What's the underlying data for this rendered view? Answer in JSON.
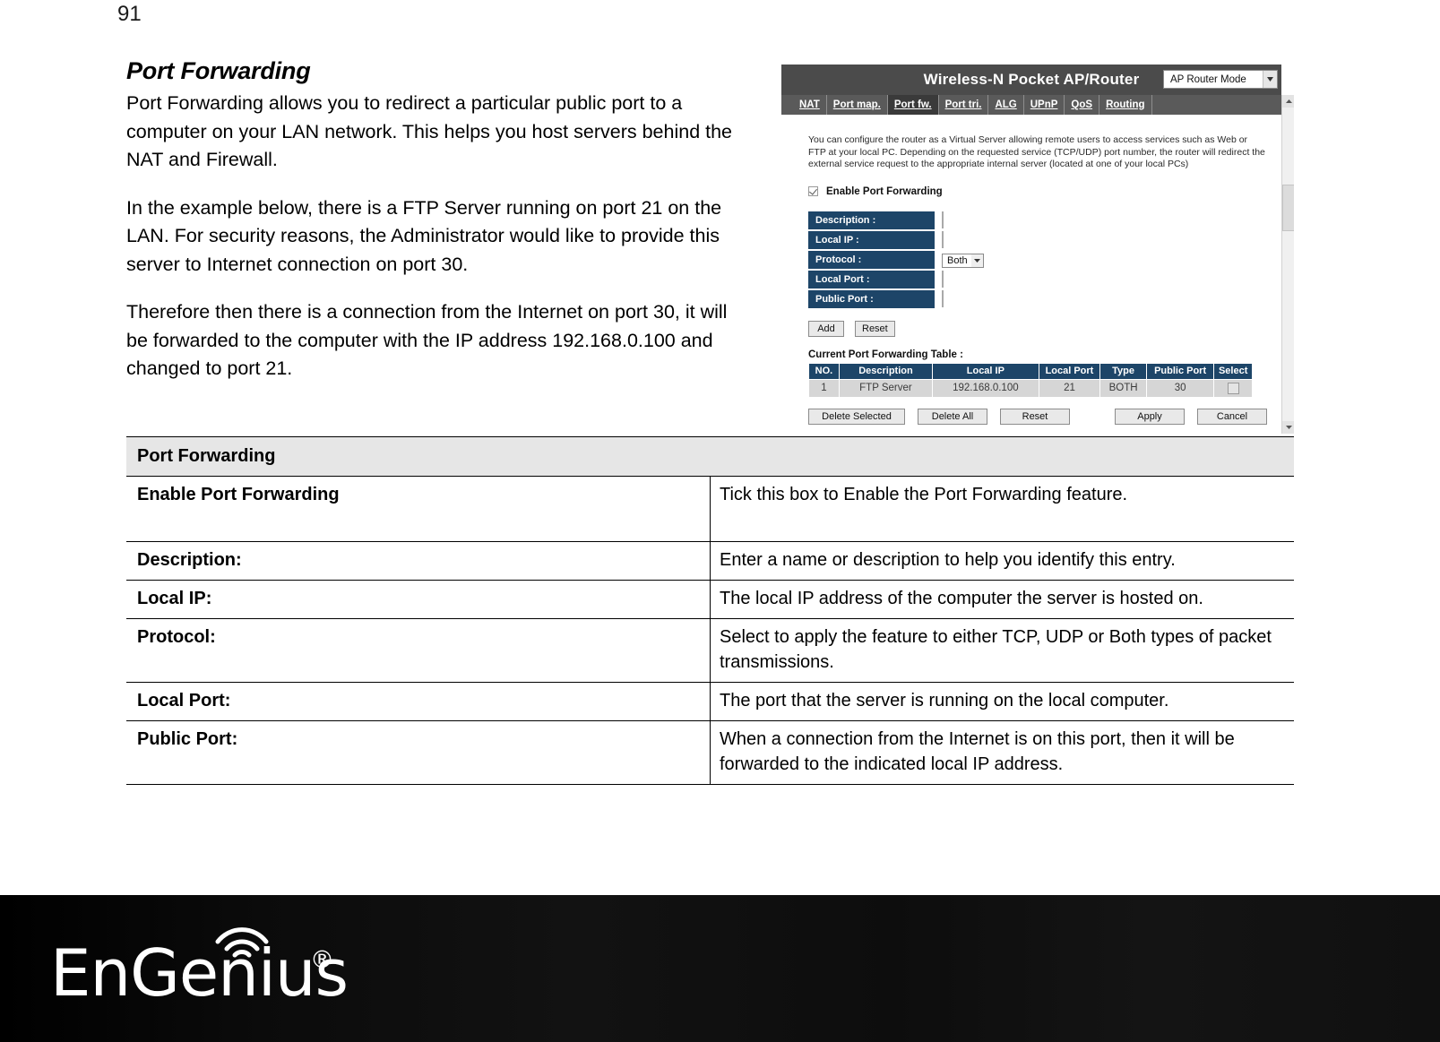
{
  "page": {
    "number": "91"
  },
  "doc": {
    "section_title": "Port Forwarding",
    "paragraphs": [
      "Port Forwarding allows you to redirect a particular public port to a computer on your LAN network. This helps you host servers behind the NAT and Firewall.",
      "In the example below, there is a FTP Server running on port 21 on the LAN. For security reasons, the Administrator would like to provide this server to Internet connection on port 30.",
      "Therefore then there is a connection from the Internet on port 30, it will be forwarded to the computer with the IP address 192.168.0.100 and changed to port 21."
    ]
  },
  "screenshot": {
    "title": "Wireless-N Pocket AP/Router",
    "mode_select": {
      "value": "AP Router Mode",
      "arrow_icon": "chevron-down-icon"
    },
    "nav": [
      {
        "label": "NAT",
        "active": false
      },
      {
        "label": "Port map.",
        "active": false
      },
      {
        "label": "Port fw.",
        "active": true
      },
      {
        "label": "Port tri.",
        "active": false
      },
      {
        "label": "ALG",
        "active": false
      },
      {
        "label": "UPnP",
        "active": false
      },
      {
        "label": "QoS",
        "active": false
      },
      {
        "label": "Routing",
        "active": false
      }
    ],
    "intro": "You can configure the router as a Virtual Server allowing remote users to access services such as Web or FTP at your local PC. Depending on the requested service (TCP/UDP) port number, the router will redirect the external service request to the appropriate internal server (located at one of your local PCs)",
    "enable_checkbox": {
      "label": "Enable Port Forwarding",
      "checked": true
    },
    "form": [
      {
        "label": "Description :",
        "value": "",
        "control": "text"
      },
      {
        "label": "Local IP :",
        "value": "",
        "control": "text"
      },
      {
        "label": "Protocol :",
        "value": "Both",
        "control": "select"
      },
      {
        "label": "Local Port :",
        "value": "",
        "control": "text"
      },
      {
        "label": "Public Port :",
        "value": "",
        "control": "text"
      }
    ],
    "form_buttons": [
      "Add",
      "Reset"
    ],
    "table_caption": "Current Port Forwarding Table :",
    "table_headers": [
      "NO.",
      "Description",
      "Local IP",
      "Local Port",
      "Type",
      "Public Port",
      "Select"
    ],
    "table_rows": [
      {
        "no": "1",
        "description": "FTP Server",
        "local_ip": "192.168.0.100",
        "local_port": "21",
        "type": "BOTH",
        "public_port": "30",
        "selected": false
      }
    ],
    "bottom_buttons_left": [
      "Delete Selected",
      "Delete All",
      "Reset"
    ],
    "bottom_buttons_right": [
      "Apply",
      "Cancel"
    ]
  },
  "desc_table": {
    "header": "Port Forwarding",
    "rows": [
      {
        "key": "Enable Port Forwarding",
        "value": "Tick this box to Enable the Port Forwarding feature."
      },
      {
        "key": "Description:",
        "value": "Enter a name or description to help you identify this entry."
      },
      {
        "key": "Local IP:",
        "value": "The local IP address of the computer the server is hosted on."
      },
      {
        "key": "Protocol:",
        "value": "Select to apply the feature to either TCP, UDP or Both types of packet transmissions."
      },
      {
        "key": "Local Port:",
        "value": "The port that the server is running on the local computer."
      },
      {
        "key": "Public Port:",
        "value": "When a connection from the Internet is on this port, then it will be forwarded to the indicated local IP address."
      }
    ]
  },
  "footer": {
    "brand": "EnGenius",
    "registered_mark": "®",
    "wifi_icon": "wifi-signal-icon"
  }
}
